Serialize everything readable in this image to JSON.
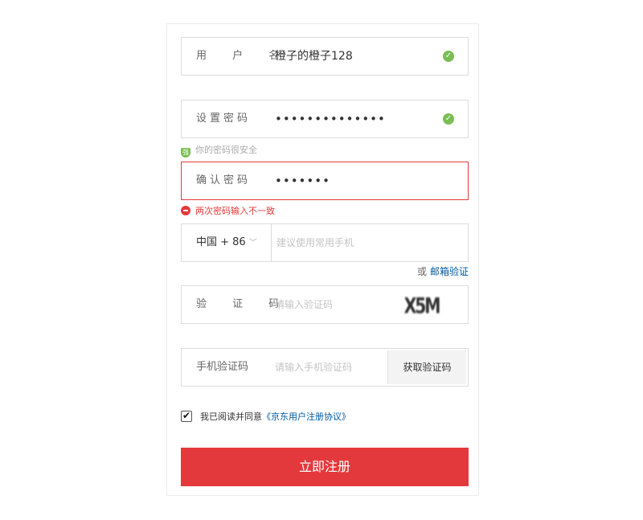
{
  "form": {
    "username": {
      "label": "用 户 名",
      "value": "橙子的橙子128"
    },
    "password": {
      "label": "设置密码",
      "value": "••••••••••••••",
      "hint": "你的密码很安全"
    },
    "confirm": {
      "label": "确认密码",
      "value": "•••••••",
      "error": "两次密码输入不一致"
    },
    "phone": {
      "country": "中国 + 86",
      "placeholder": "建议使用常用手机",
      "or_text": "或",
      "email_link": "邮箱验证"
    },
    "captcha": {
      "label": "验 证 码",
      "placeholder": "请输入验证码",
      "image_text": "X5M"
    },
    "sms": {
      "label": "手机验证码",
      "placeholder": "请输入手机验证码",
      "button": "获取验证码"
    },
    "agreement": {
      "text": "我已阅读并同意",
      "link": "《京东用户注册协议》",
      "checked": true
    },
    "submit_label": "立即注册"
  },
  "colors": {
    "accent": "#e4393c",
    "success": "#7abd54",
    "link": "#005aa0"
  },
  "icons": {
    "valid": "check-circle-icon",
    "secure": "shield-icon",
    "error": "minus-circle-icon",
    "dropdown": "chevron-down-icon"
  }
}
